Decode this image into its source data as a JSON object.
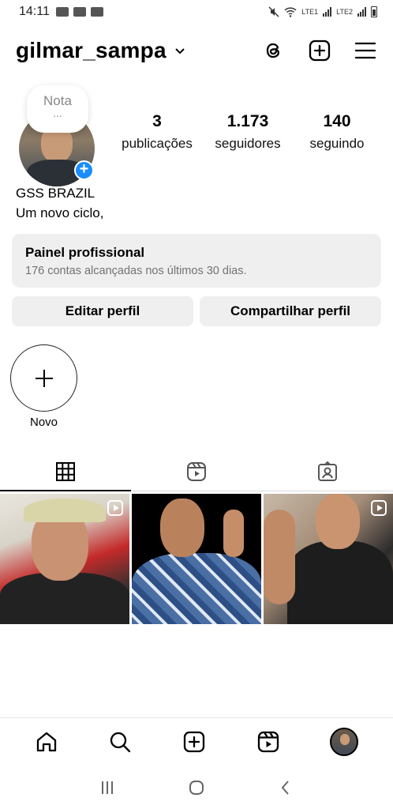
{
  "status_bar": {
    "time": "14:11",
    "lte1": "LTE1",
    "lte2": "LTE2"
  },
  "header": {
    "username": "gilmar_sampa"
  },
  "profile": {
    "note_label": "Nota",
    "note_dots": "...",
    "display_name": "GSS BRAZIL",
    "bio": "Um novo ciclo,"
  },
  "stats": [
    {
      "value": "3",
      "label": "publicações"
    },
    {
      "value": "1.173",
      "label": "seguidores"
    },
    {
      "value": "140",
      "label": "seguindo"
    }
  ],
  "dashboard": {
    "title": "Painel profissional",
    "subtitle": "176 contas alcançadas nos últimos 30 dias."
  },
  "buttons": {
    "edit": "Editar perfil",
    "share": "Compartilhar perfil"
  },
  "highlights": {
    "new_label": "Novo"
  },
  "icons": {
    "header": [
      "threads-icon",
      "create-icon",
      "menu-icon"
    ],
    "tabs": [
      "grid-icon",
      "reels-icon",
      "tagged-icon"
    ],
    "bottom_nav": [
      "home-icon",
      "search-icon",
      "create-icon",
      "reels-icon",
      "profile-avatar"
    ],
    "system_nav": [
      "recents-icon",
      "home-circle-icon",
      "back-icon"
    ]
  },
  "colors": {
    "accent": "#1a8cff",
    "button_bg": "#efefef",
    "muted_text": "#737373"
  }
}
